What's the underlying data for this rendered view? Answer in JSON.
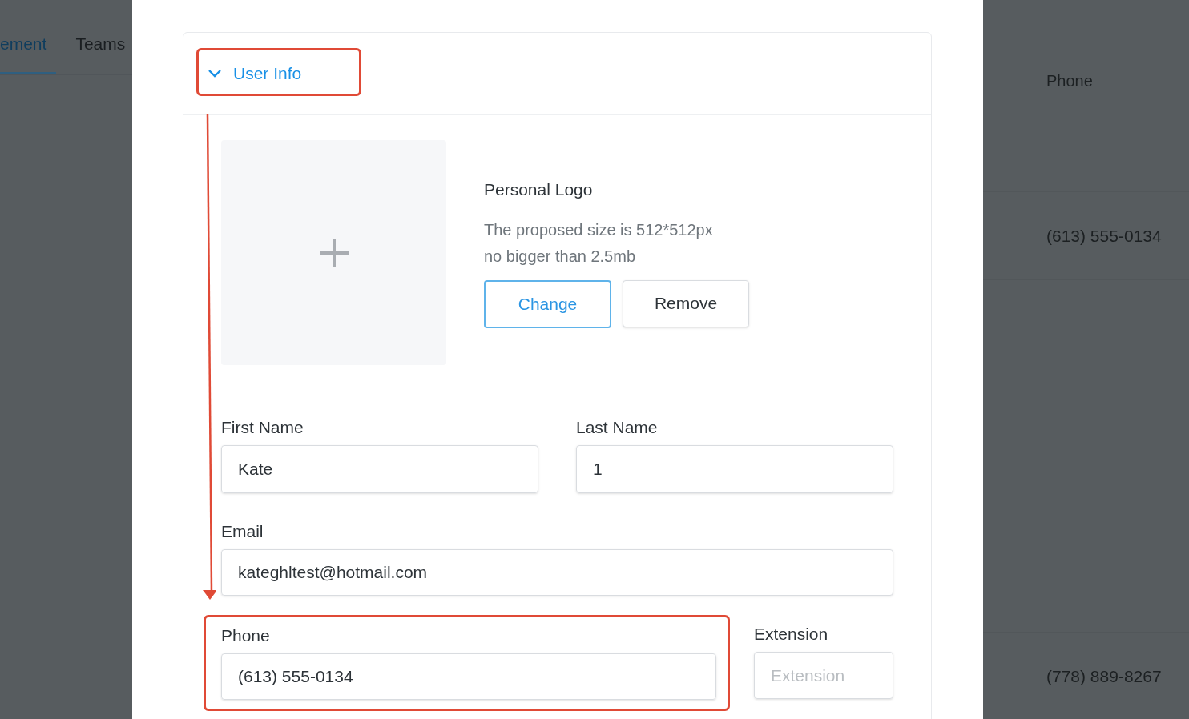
{
  "background": {
    "tabs": [
      {
        "label": "ement",
        "selected": true
      },
      {
        "label": "Teams",
        "selected": false
      }
    ],
    "table": {
      "column_header": "Phone",
      "rows": [
        "",
        "(613) 555-0134",
        "",
        "",
        "",
        "",
        "(778) 889-8267"
      ]
    }
  },
  "panel": {
    "title": "User Info",
    "expanded": true,
    "logo": {
      "title": "Personal Logo",
      "hint_lines": [
        "The proposed size is 512*512px",
        "no bigger than 2.5mb"
      ],
      "buttons": [
        {
          "label": "Change",
          "kind": "primary"
        },
        {
          "label": "Remove",
          "kind": "default"
        }
      ]
    },
    "fields": [
      {
        "label": "First Name",
        "value": "Kate"
      },
      {
        "label": "Last Name",
        "value": "1"
      },
      {
        "label": "Email",
        "value": "kateghltest@hotmail.com"
      },
      {
        "label": "Phone",
        "value": "(613) 555-0134"
      },
      {
        "label": "Extension",
        "placeholder": "Extension"
      }
    ]
  }
}
